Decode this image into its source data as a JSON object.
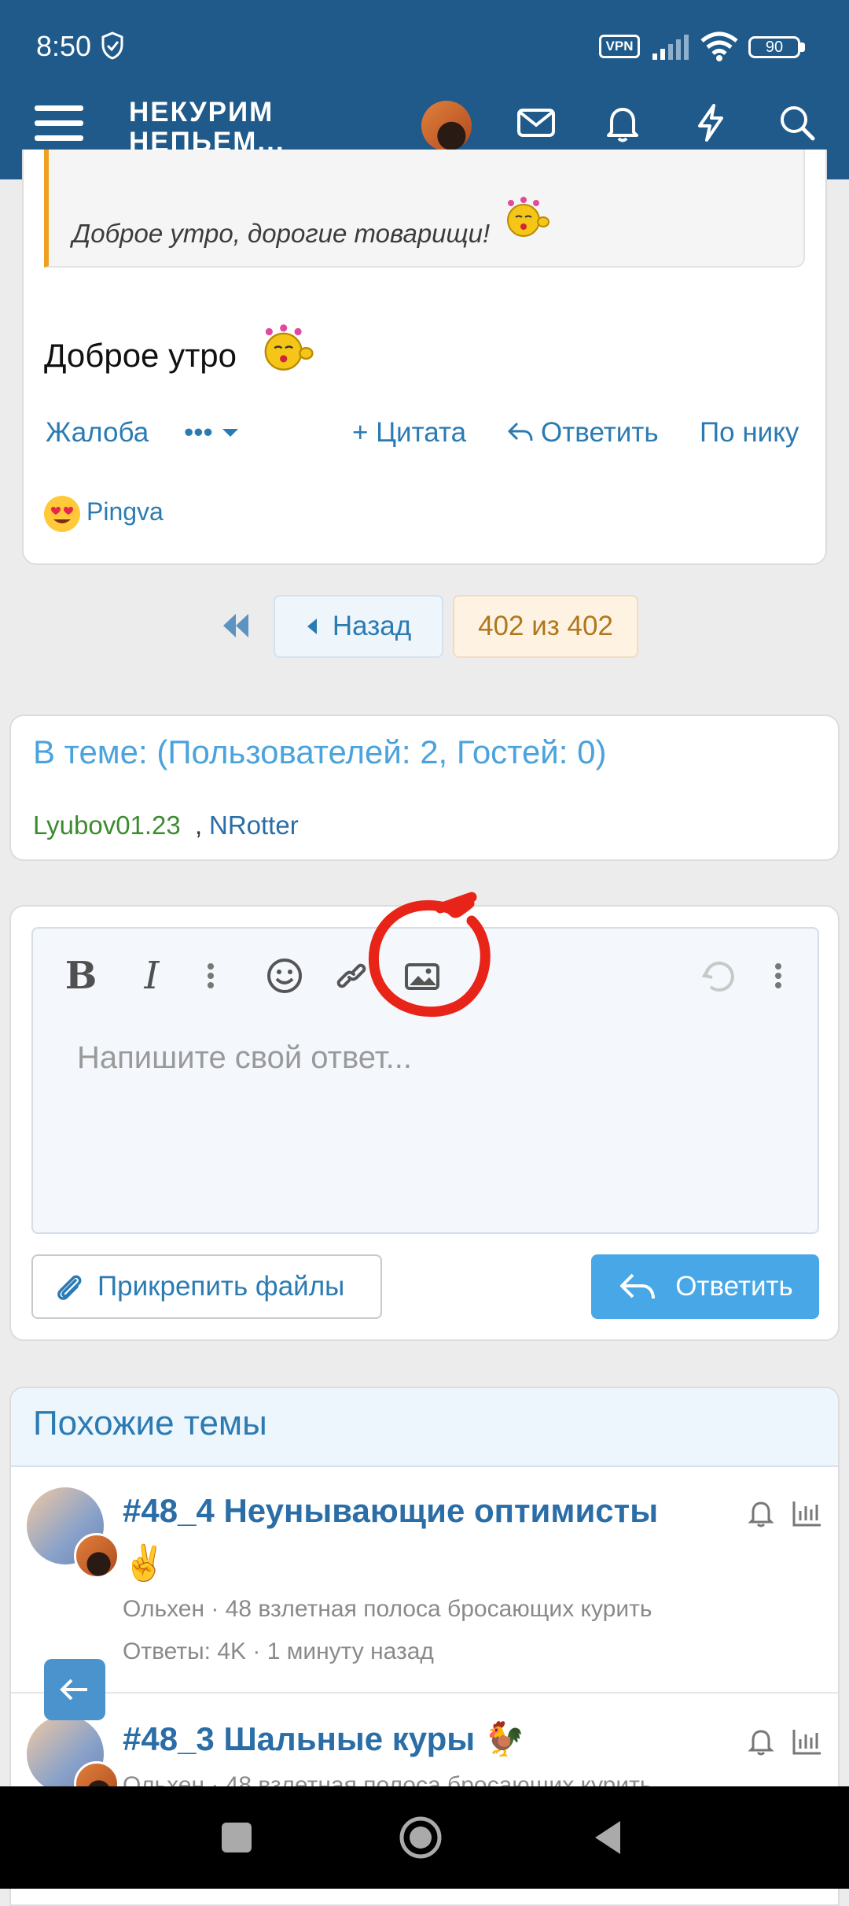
{
  "status_bar": {
    "time": "8:50",
    "vpn": "VPN",
    "battery": "90"
  },
  "header": {
    "logo_line1": "НЕКУРИМ",
    "logo_line2": "НЕПЬЕМ..."
  },
  "post": {
    "quote_text": "Доброе утро, дорогие товарищи!",
    "text": "Доброе утро",
    "actions": {
      "report": "Жалоба",
      "more": "•••",
      "quote": "+ Цитата",
      "reply": "Ответить",
      "by_nick": "По нику"
    },
    "reaction_user": "Pingva"
  },
  "pagination": {
    "back": "Назад",
    "current": "402 из 402"
  },
  "users_online": {
    "title": "В теме: (Пользователей: 2, Гостей: 0)",
    "user1": "Lyubov01.23",
    "separator": ",",
    "user2": "NRotter"
  },
  "editor": {
    "placeholder": "Напишите свой ответ...",
    "attach_label": "Прикрепить файлы",
    "reply_label": "Ответить"
  },
  "similar": {
    "title": "Похожие темы",
    "threads": [
      {
        "title": "#48_4 Неунывающие оптимисты",
        "emoji": "✌️",
        "meta": "Ольхен · 48 взлетная полоса бросающих курить",
        "stats": "Ответы: 4K · 1 минуту назад"
      },
      {
        "title": "#48_3 Шальные куры",
        "emoji": "🐓",
        "meta": "Ольхен · 48 взлетная полоса бросающих курить"
      }
    ]
  },
  "colors": {
    "header": "#1f5a8a",
    "link": "#2b7bb3",
    "accent": "#47a7e7",
    "annotation": "#e82418"
  },
  "icons": [
    "menu-icon",
    "avatar",
    "mail-icon",
    "bell-icon",
    "bolt-icon",
    "search-icon",
    "image-icon",
    "smiley-icon",
    "link-icon",
    "undo-icon",
    "paperclip-icon",
    "reply-icon"
  ]
}
